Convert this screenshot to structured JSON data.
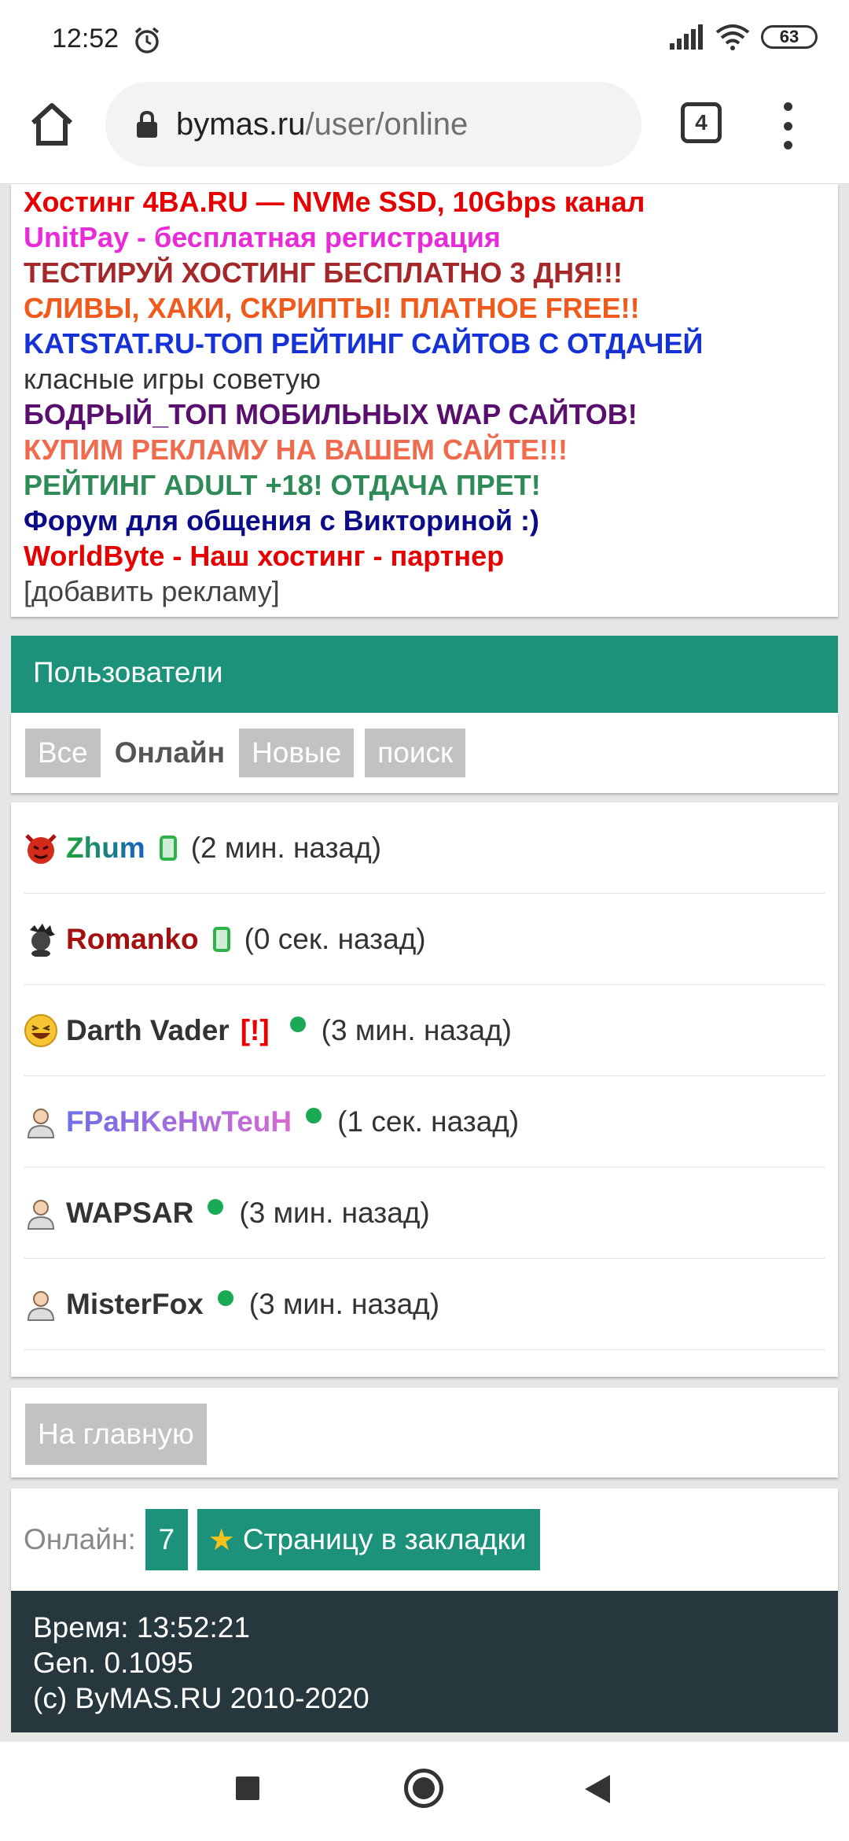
{
  "status_bar": {
    "time": "12:52",
    "battery": "63"
  },
  "browser": {
    "url_host": "bymas.ru",
    "url_path": "/user/online",
    "tab_count": "4"
  },
  "ads": [
    {
      "text": "Хостинг 4BA.RU — NVMe SSD, 10Gbps канал",
      "color": "#e60000"
    },
    {
      "text": "UnitPay - бесплатная регистрация",
      "color": "#e82ad8"
    },
    {
      "text": "ТЕСТИРУЙ ХОСТИНГ БЕСПЛАТНО 3 ДНЯ!!!",
      "color": "#a4282a"
    },
    {
      "text": "СЛИВЫ, ХАКИ, СКРИПТЫ! ПЛАТНОЕ FREE!!",
      "color": "#f05a1c"
    },
    {
      "text": "KATSTAT.RU-ТОП РЕЙТИНГ САЙТОВ С ОТДАЧЕЙ",
      "color": "#1432d8"
    },
    {
      "text": "класные игры советую",
      "color": "#333333"
    },
    {
      "text": "БОДРЫЙ_ТОП МОБИЛЬНЫХ WAP САЙТОВ!",
      "color": "#5a0f6e"
    },
    {
      "text": "КУПИМ РЕКЛАМУ НА ВАШЕМ САЙТЕ!!!",
      "color": "#f06a4e"
    },
    {
      "text": "РЕЙТИНГ ADULT +18! ОТДАЧА ПРЕТ!",
      "color": "#2e8b57"
    },
    {
      "text": "Форум для общения с Викториной :)",
      "color": "#0b0b8a"
    },
    {
      "text": "WorldByte - Наш хостинг - партнер",
      "color": "#e60000"
    },
    {
      "text": "[добавить рекламу]",
      "color": "#444444"
    }
  ],
  "users_section": {
    "title": "Пользователи",
    "filters": [
      "Все",
      "Онлайн",
      "Новые",
      "поиск"
    ]
  },
  "users": [
    {
      "name": "Zhum",
      "status": "mobile",
      "time": "(2 мин. назад)",
      "avatar": "devil-avatar-icon"
    },
    {
      "name": "Romanko",
      "status": "mobile",
      "time": "(0 сек. назад)",
      "avatar": "dark-avatar-icon"
    },
    {
      "name": "Darth Vader",
      "badge": "[!]",
      "status": "online",
      "time": "(3 мин. назад)",
      "avatar": "laughing-smiley-icon"
    },
    {
      "name": "FPaHKeHwTeuH",
      "status": "online",
      "time": "(1 сек. назад)",
      "avatar": "user-silhouette-icon"
    },
    {
      "name": "WAPSAR",
      "status": "online",
      "time": "(3 мин. назад)",
      "avatar": "user-silhouette-icon"
    },
    {
      "name": "MisterFox",
      "status": "online",
      "time": "(3 мин. назад)",
      "avatar": "user-silhouette-icon"
    }
  ],
  "home_button": "На главную",
  "online": {
    "label": "Онлайн:",
    "count": "7",
    "bookmark_label": "Страницу в закладки"
  },
  "footer": {
    "time": "Время: 13:52:21",
    "gen": "Gen. 0.1095",
    "copyright": "(c) ByMAS.RU 2010-2020"
  },
  "colors": {
    "accent": "#1b9279",
    "footer_bg": "#26373d",
    "online_dot": "#1aaa55"
  }
}
